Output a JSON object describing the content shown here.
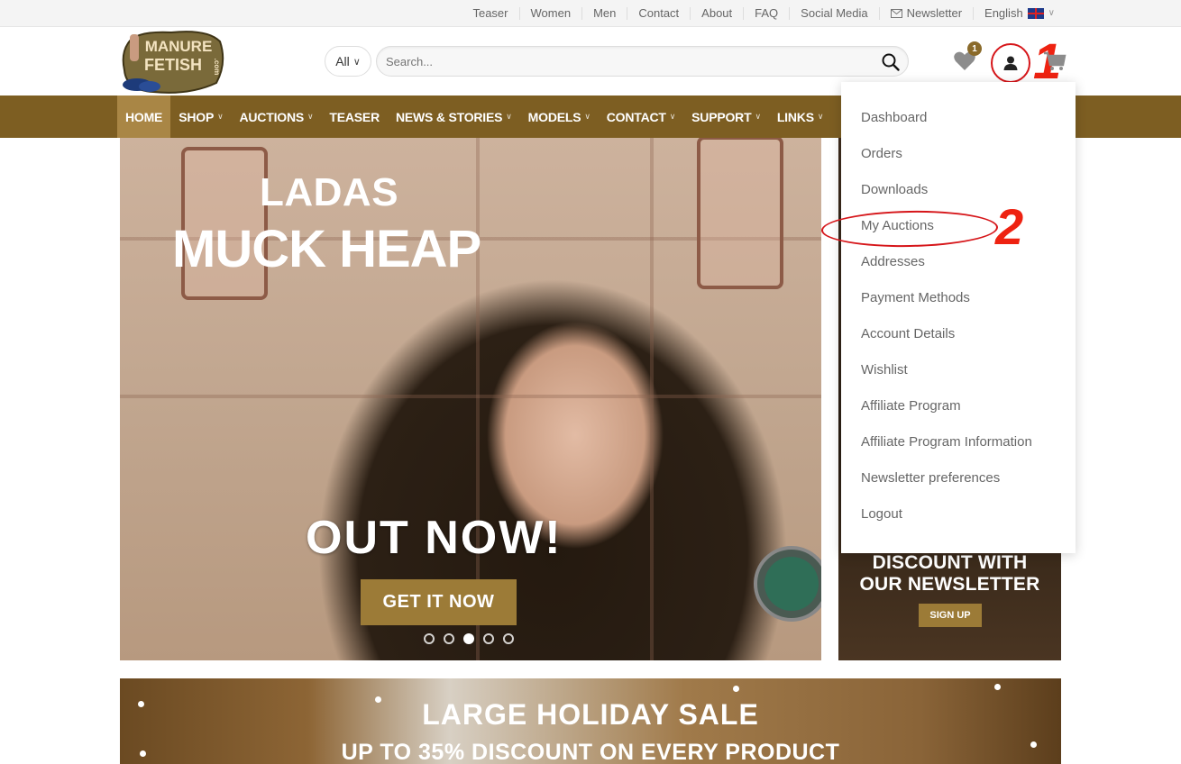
{
  "topnav": {
    "items": [
      "Teaser",
      "Women",
      "Men",
      "Contact",
      "About",
      "FAQ",
      "Social Media",
      "Newsletter"
    ],
    "language": "English"
  },
  "header": {
    "logo_text": [
      "MANURE",
      "FETISH",
      ".com"
    ],
    "category_select": "All",
    "search_placeholder": "Search...",
    "wishlist_count": "1",
    "annotation_1": "1"
  },
  "nav": {
    "items": [
      {
        "label": "HOME",
        "active": true
      },
      {
        "label": "SHOP",
        "dropdown": true
      },
      {
        "label": "AUCTIONS",
        "dropdown": true
      },
      {
        "label": "TEASER"
      },
      {
        "label": "NEWS & STORIES",
        "dropdown": true
      },
      {
        "label": "MODELS",
        "dropdown": true
      },
      {
        "label": "CONTACT",
        "dropdown": true
      },
      {
        "label": "SUPPORT",
        "dropdown": true
      },
      {
        "label": "LINKS",
        "dropdown": true
      }
    ]
  },
  "hero": {
    "subtitle": "LADAS",
    "title": "MUCK HEAP",
    "tagline": "OUT NOW!",
    "button": "GET IT NOW",
    "slides": 5,
    "active_slide": 3
  },
  "side_banner": {
    "line1": "DISCOUNT WITH",
    "line2": "OUR NEWSLETTER",
    "button": "SIGN UP"
  },
  "account_menu": {
    "items": [
      "Dashboard",
      "Orders",
      "Downloads",
      "My Auctions",
      "Addresses",
      "Payment Methods",
      "Account Details",
      "Wishlist",
      "Affiliate Program",
      "Affiliate Program Information",
      "Newsletter preferences",
      "Logout"
    ],
    "annotation_2": "2"
  },
  "holiday": {
    "title": "LARGE HOLIDAY SALE",
    "subtitle": "UP TO 35% DISCOUNT ON EVERY PRODUCT"
  },
  "colors": {
    "nav_bg": "#7d5e22",
    "nav_active": "#a98645",
    "button": "#9c7b37",
    "annotation": "#e21111"
  }
}
